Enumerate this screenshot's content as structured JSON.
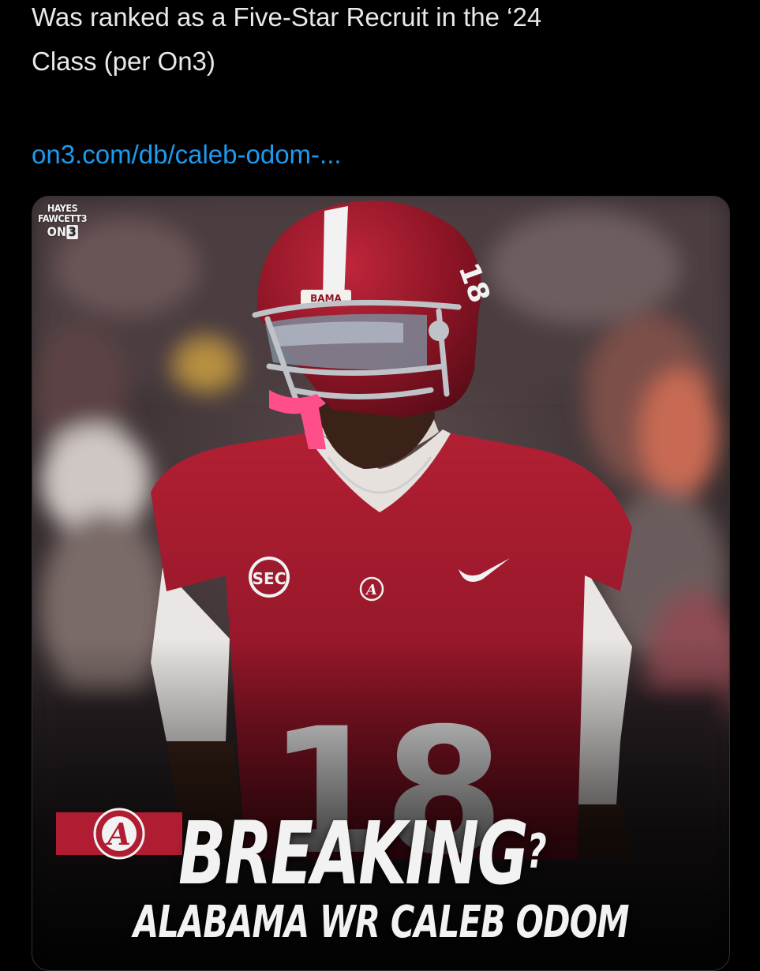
{
  "tweet": {
    "text_line_1": "Was ranked as a Five-Star Recruit in the ‘24",
    "text_line_2": "Class (per On3)",
    "link": "on3.com/db/caleb-odom-..."
  },
  "media": {
    "watermark_line_1": "HAYES",
    "watermark_line_2": "FAWCETT3",
    "watermark_brand_text": "ON",
    "watermark_brand_num": "3",
    "helmet_text": "BAMA",
    "jersey_number": "18",
    "jersey_patch": "SEC",
    "team_logo_letter": "A",
    "headline": "BREAKING",
    "headline_suffix": "?",
    "subheadline": "ALABAMA WR CALEB ODOM"
  },
  "colors": {
    "background": "#000000",
    "text": "#e7e9ea",
    "link": "#1d9bf0",
    "crimson": "#a3192b",
    "mouthguard": "#ff4f8b"
  }
}
